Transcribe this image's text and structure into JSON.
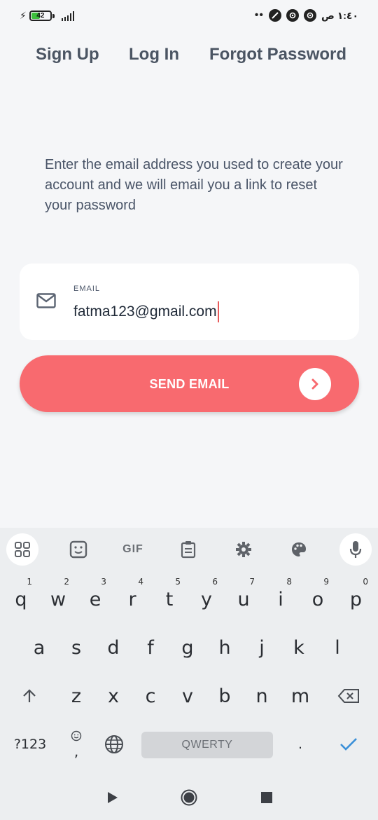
{
  "status_bar": {
    "battery_level": "42",
    "time": "١:٤٠ ص",
    "dots": "••"
  },
  "nav": {
    "signup": "Sign Up",
    "login": "Log In",
    "forgot": "Forgot Password"
  },
  "instructions": "Enter the email address you used to create your account and we will email you a link to reset your password",
  "email_field": {
    "label": "EMAIL",
    "value": "fatma123@gmail.com"
  },
  "send_button": {
    "label": "SEND EMAIL"
  },
  "keyboard": {
    "toolbar": {
      "gif_label": "GIF"
    },
    "row1": [
      {
        "key": "q",
        "hint": "1"
      },
      {
        "key": "w",
        "hint": "2"
      },
      {
        "key": "e",
        "hint": "3"
      },
      {
        "key": "r",
        "hint": "4"
      },
      {
        "key": "t",
        "hint": "5"
      },
      {
        "key": "y",
        "hint": "6"
      },
      {
        "key": "u",
        "hint": "7"
      },
      {
        "key": "i",
        "hint": "8"
      },
      {
        "key": "o",
        "hint": "9"
      },
      {
        "key": "p",
        "hint": "0"
      }
    ],
    "row2": [
      "a",
      "s",
      "d",
      "f",
      "g",
      "h",
      "j",
      "k",
      "l"
    ],
    "row3": [
      "z",
      "x",
      "c",
      "v",
      "b",
      "n",
      "m"
    ],
    "row4": {
      "symbols": "?123",
      "comma": ",",
      "space_label": "QWERTY",
      "period": "."
    }
  },
  "colors": {
    "accent": "#f86a6f",
    "background": "#f5f6f8",
    "caret": "#e85a5a",
    "enter_check": "#3a8fd8"
  }
}
